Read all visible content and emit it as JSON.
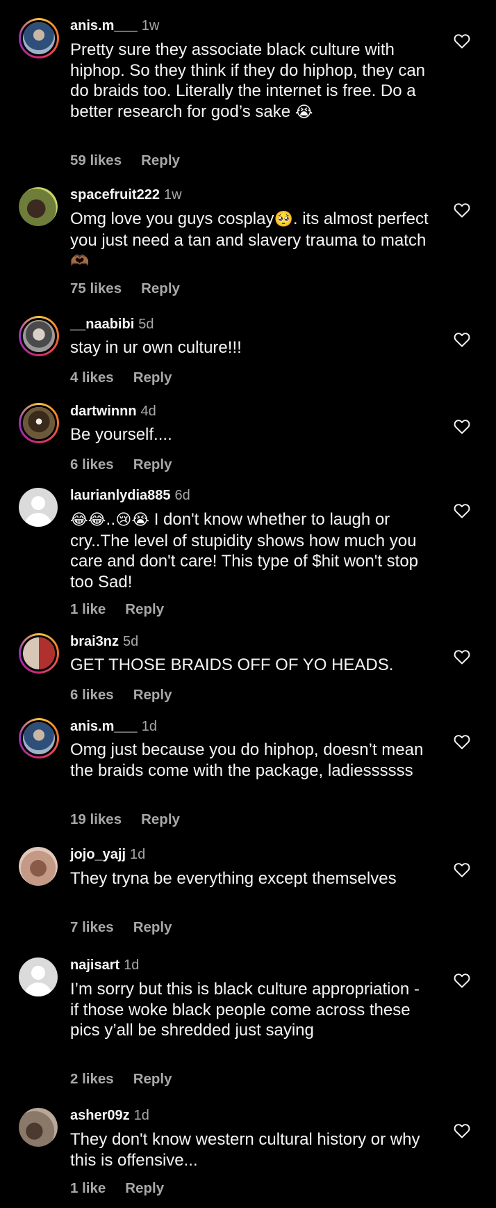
{
  "comments": [
    {
      "username": "anis.m___",
      "time": "1w",
      "text": "Pretty sure they associate black culture with hiphop. So they think if they do hiphop, they can do braids too. Literally the internet is free. Do a better research for god’s sake",
      "emoji": "😭",
      "likes": "59 likes",
      "reply": "Reply",
      "avatar_color": "#3b5e8c"
    },
    {
      "username": "spacefruit222",
      "time": "1w",
      "text": "Omg love you guys cosplay",
      "emoji_inline": "🥺",
      "text_after": ". its almost perfect you just need a tan and slavery trauma to match",
      "emoji": "🫶🏾",
      "likes": "75 likes",
      "reply": "Reply",
      "avatar_color": "#6f7d3a"
    },
    {
      "username": "__naabibi",
      "time": "5d",
      "text": "stay in ur own culture!!!",
      "likes": "4 likes",
      "reply": "Reply",
      "avatar_color": "#8a8a8a"
    },
    {
      "username": "dartwinnn",
      "time": "4d",
      "text": "Be yourself....",
      "likes": "6 likes",
      "reply": "Reply",
      "avatar_color": "#5a4a3a"
    },
    {
      "username": "laurianlydia885",
      "time": "6d",
      "emoji_prefix": "😂😂..😢😭",
      "text": " I don't know whether to laugh or cry..The level of stupidity shows how much you care and don't care!  This type of $hit won't stop too Sad!",
      "likes": "1 like",
      "reply": "Reply"
    },
    {
      "username": "brai3nz",
      "time": "5d",
      "text": "GET THOSE BRAIDS OFF OF YO HEADS.",
      "likes": "6 likes",
      "reply": "Reply",
      "avatar_color": "#a03a3a"
    },
    {
      "username": "anis.m___",
      "time": "1d",
      "text": "Omg just because you do hiphop, doesn’t mean the braids come with the package, ladiessssss",
      "likes": "19 likes",
      "reply": "Reply",
      "avatar_color": "#3b5e8c"
    },
    {
      "username": "jojo_yajj",
      "time": "1d",
      "text": "They tryna be everything except themselves",
      "likes": "7 likes",
      "reply": "Reply",
      "avatar_color": "#b08a78"
    },
    {
      "username": "najisart",
      "time": "1d",
      "text": "I’m sorry but this is black culture appropriation - if those woke black people come across these pics y’all be shredded just saying",
      "likes": "2 likes",
      "reply": "Reply"
    },
    {
      "username": "asher09z",
      "time": "1d",
      "text": "They don't know western cultural history or why this is offensive...",
      "likes": "1 like",
      "reply": "Reply",
      "avatar_color": "#7a6a5a"
    }
  ],
  "icons": {
    "heart": "heart-outline-icon",
    "default_avatar": "default-avatar-icon"
  },
  "colors": {
    "background": "#000000",
    "text": "#f5f5f5",
    "secondary": "#a8a8a8"
  }
}
